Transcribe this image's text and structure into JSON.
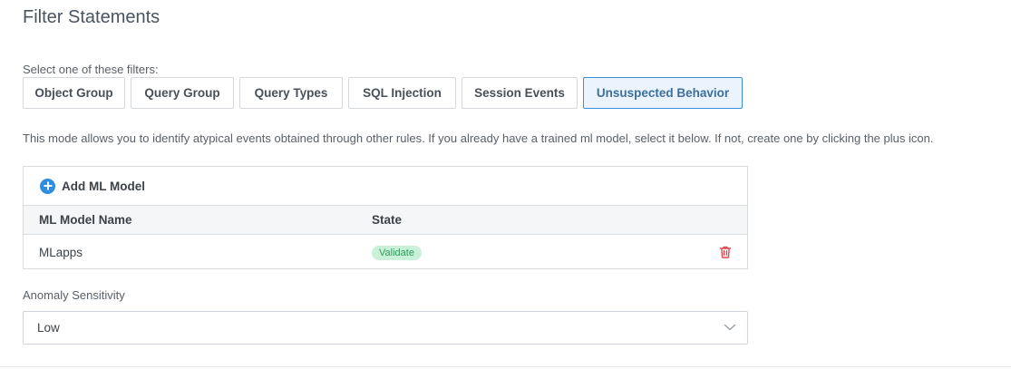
{
  "header": {
    "title": "Filter Statements"
  },
  "filters": {
    "label": "Select one of these filters:",
    "tabs": [
      {
        "label": "Object Group",
        "active": false
      },
      {
        "label": "Query Group",
        "active": false
      },
      {
        "label": "Query Types",
        "active": false
      },
      {
        "label": "SQL Injection",
        "active": false
      },
      {
        "label": "Session Events",
        "active": false
      },
      {
        "label": "Unsuspected Behavior",
        "active": true
      }
    ],
    "description": "This mode allows you to identify atypical events obtained through other rules. If you already have a trained ml model, select it below. If not, create one by clicking the plus icon."
  },
  "ml_table": {
    "add_label": "Add ML Model",
    "add_icon": "plus-circle-icon",
    "columns": [
      "ML Model Name",
      "State"
    ],
    "rows": [
      {
        "name": "MLapps",
        "state": "Validate",
        "action_icon": "trash-icon"
      }
    ]
  },
  "sensitivity": {
    "label": "Anomaly Sensitivity",
    "selected": "Low",
    "icon": "chevron-down-icon"
  },
  "colors": {
    "accent": "#2d8ee0",
    "active_tab_bg": "#ebf4fc",
    "active_tab_border": "#3a8fd8",
    "badge_bg": "#c9f0d8",
    "badge_text": "#2f9e5c",
    "delete": "#e0474f"
  }
}
